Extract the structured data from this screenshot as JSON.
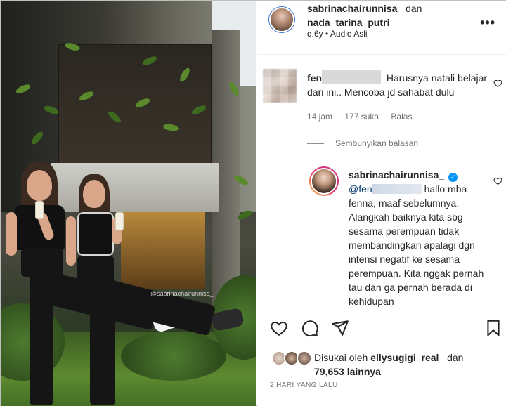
{
  "post": {
    "photo_watermark": "@sabrinachairunnisa_",
    "header": {
      "user1": "sabrinachairunnisa_",
      "conjunction": "dan",
      "user2": "nada_tarina_putri",
      "subtitle": "q.6y • Audio Asli",
      "more_label": "•••"
    },
    "comment1": {
      "user": "fen",
      "text": "Harusnya natali belajar dari ini.. Mencoba jd sahabat dulu",
      "time": "14 jam",
      "likes": "177 suka",
      "reply_label": "Balas"
    },
    "hide_replies_label": "Sembunyikan balasan",
    "reply": {
      "user": "sabrinachairunnisa_",
      "verified_glyph": "✓",
      "mention": "@fen",
      "text": "hallo mba fenna, maaf sebelumnya. Alangkah baiknya kita sbg sesama perempuan tidak membandingkan apalagi dgn intensi negatif ke sesama perempuan. Kita nggak pernah tau dan ga pernah berada di kehidupan"
    },
    "likes": {
      "prefix": "Disukai oleh",
      "user": "ellysugigi_real_",
      "suffix": "dan",
      "count": "79,653",
      "others": "lainnya"
    },
    "date": "2 HARI YANG LALU",
    "icons": {
      "like": "heart-icon",
      "comment": "comment-icon",
      "share": "share-icon",
      "save": "bookmark-icon"
    },
    "colors": {
      "text": "#262626",
      "muted": "#737373",
      "verified": "#0095f6",
      "mention": "#00376b"
    }
  }
}
